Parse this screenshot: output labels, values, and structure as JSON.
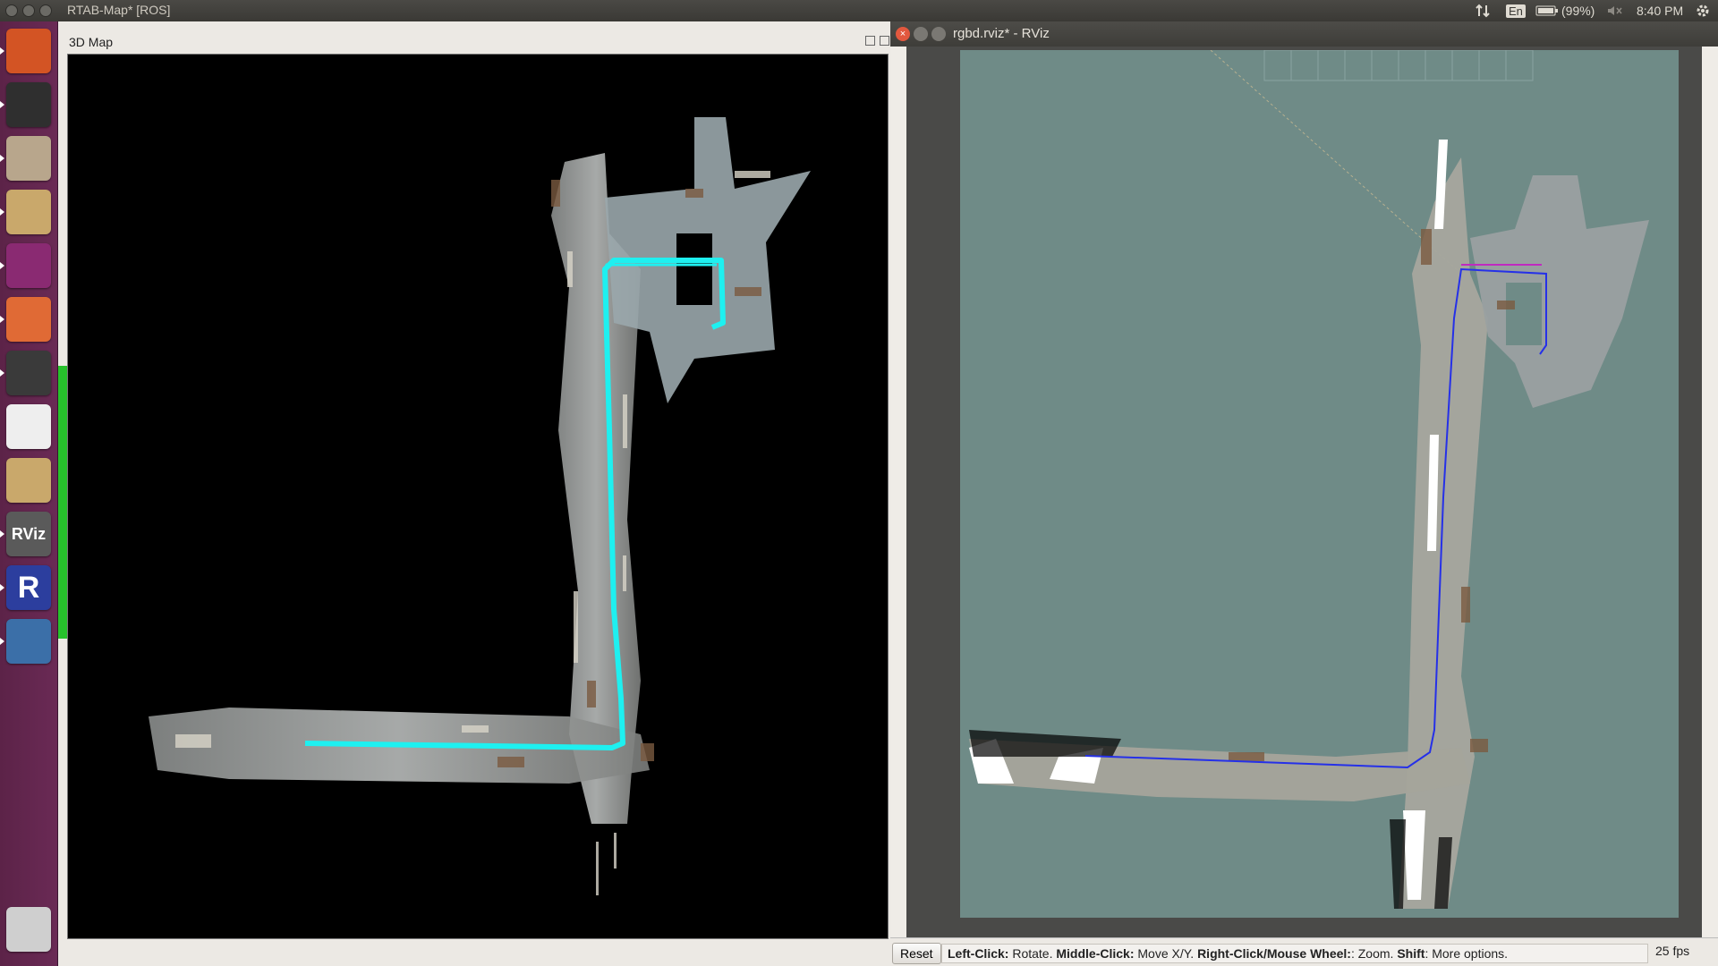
{
  "top_panel": {
    "window_title": "RTAB-Map* [ROS]",
    "keyboard_layout": "En",
    "battery": "(99%)",
    "clock": "8:40 PM",
    "icons": [
      "network-icon",
      "keyboard-icon",
      "battery-icon",
      "volume-muted-icon",
      "settings-gear-icon"
    ]
  },
  "launcher": {
    "items": [
      {
        "name": "ubuntu-dash-icon",
        "color": "#d35424"
      },
      {
        "name": "terminal-icon",
        "color": "#2f2f2f"
      },
      {
        "name": "file-cabinet-icon",
        "color": "#b8a68c"
      },
      {
        "name": "archive-download-icon",
        "color": "#c9a86b"
      },
      {
        "name": "window-app-icon",
        "color": "#8a2a72"
      },
      {
        "name": "file-manager-icon",
        "color": "#e06a35"
      },
      {
        "name": "sublime-text-icon",
        "color": "#3a3a3a"
      },
      {
        "name": "chrome-icon",
        "color": "#eeeeee"
      },
      {
        "name": "archive-globe-icon",
        "color": "#c9a86b"
      },
      {
        "name": "rviz-icon",
        "color": "#5a5a5a",
        "text": "RViz"
      },
      {
        "name": "r-app-icon",
        "color": "#2c3e9e",
        "text": "R"
      },
      {
        "name": "image-viewer-icon",
        "color": "#3b6fa8"
      },
      {
        "name": "trash-icon",
        "color": "#cfcfcf"
      }
    ]
  },
  "rtab_window": {
    "panel_title": "3D Map",
    "trajectory_color": "#1ef0f0"
  },
  "rviz_window": {
    "title": "rgbd.rviz* - RViz",
    "status": {
      "reset_label": "Reset",
      "left_click_label": "Left-Click:",
      "left_click_text": " Rotate. ",
      "middle_click_label": "Middle-Click:",
      "middle_click_text": " Move X/Y. ",
      "right_click_label": "Right-Click/Mouse Wheel:",
      "right_click_text": ": Zoom. ",
      "shift_label": "Shift",
      "shift_text": ": More options.",
      "fps": "25 fps"
    },
    "path_color": "#2530e8",
    "background_color": "#6f8b87"
  }
}
